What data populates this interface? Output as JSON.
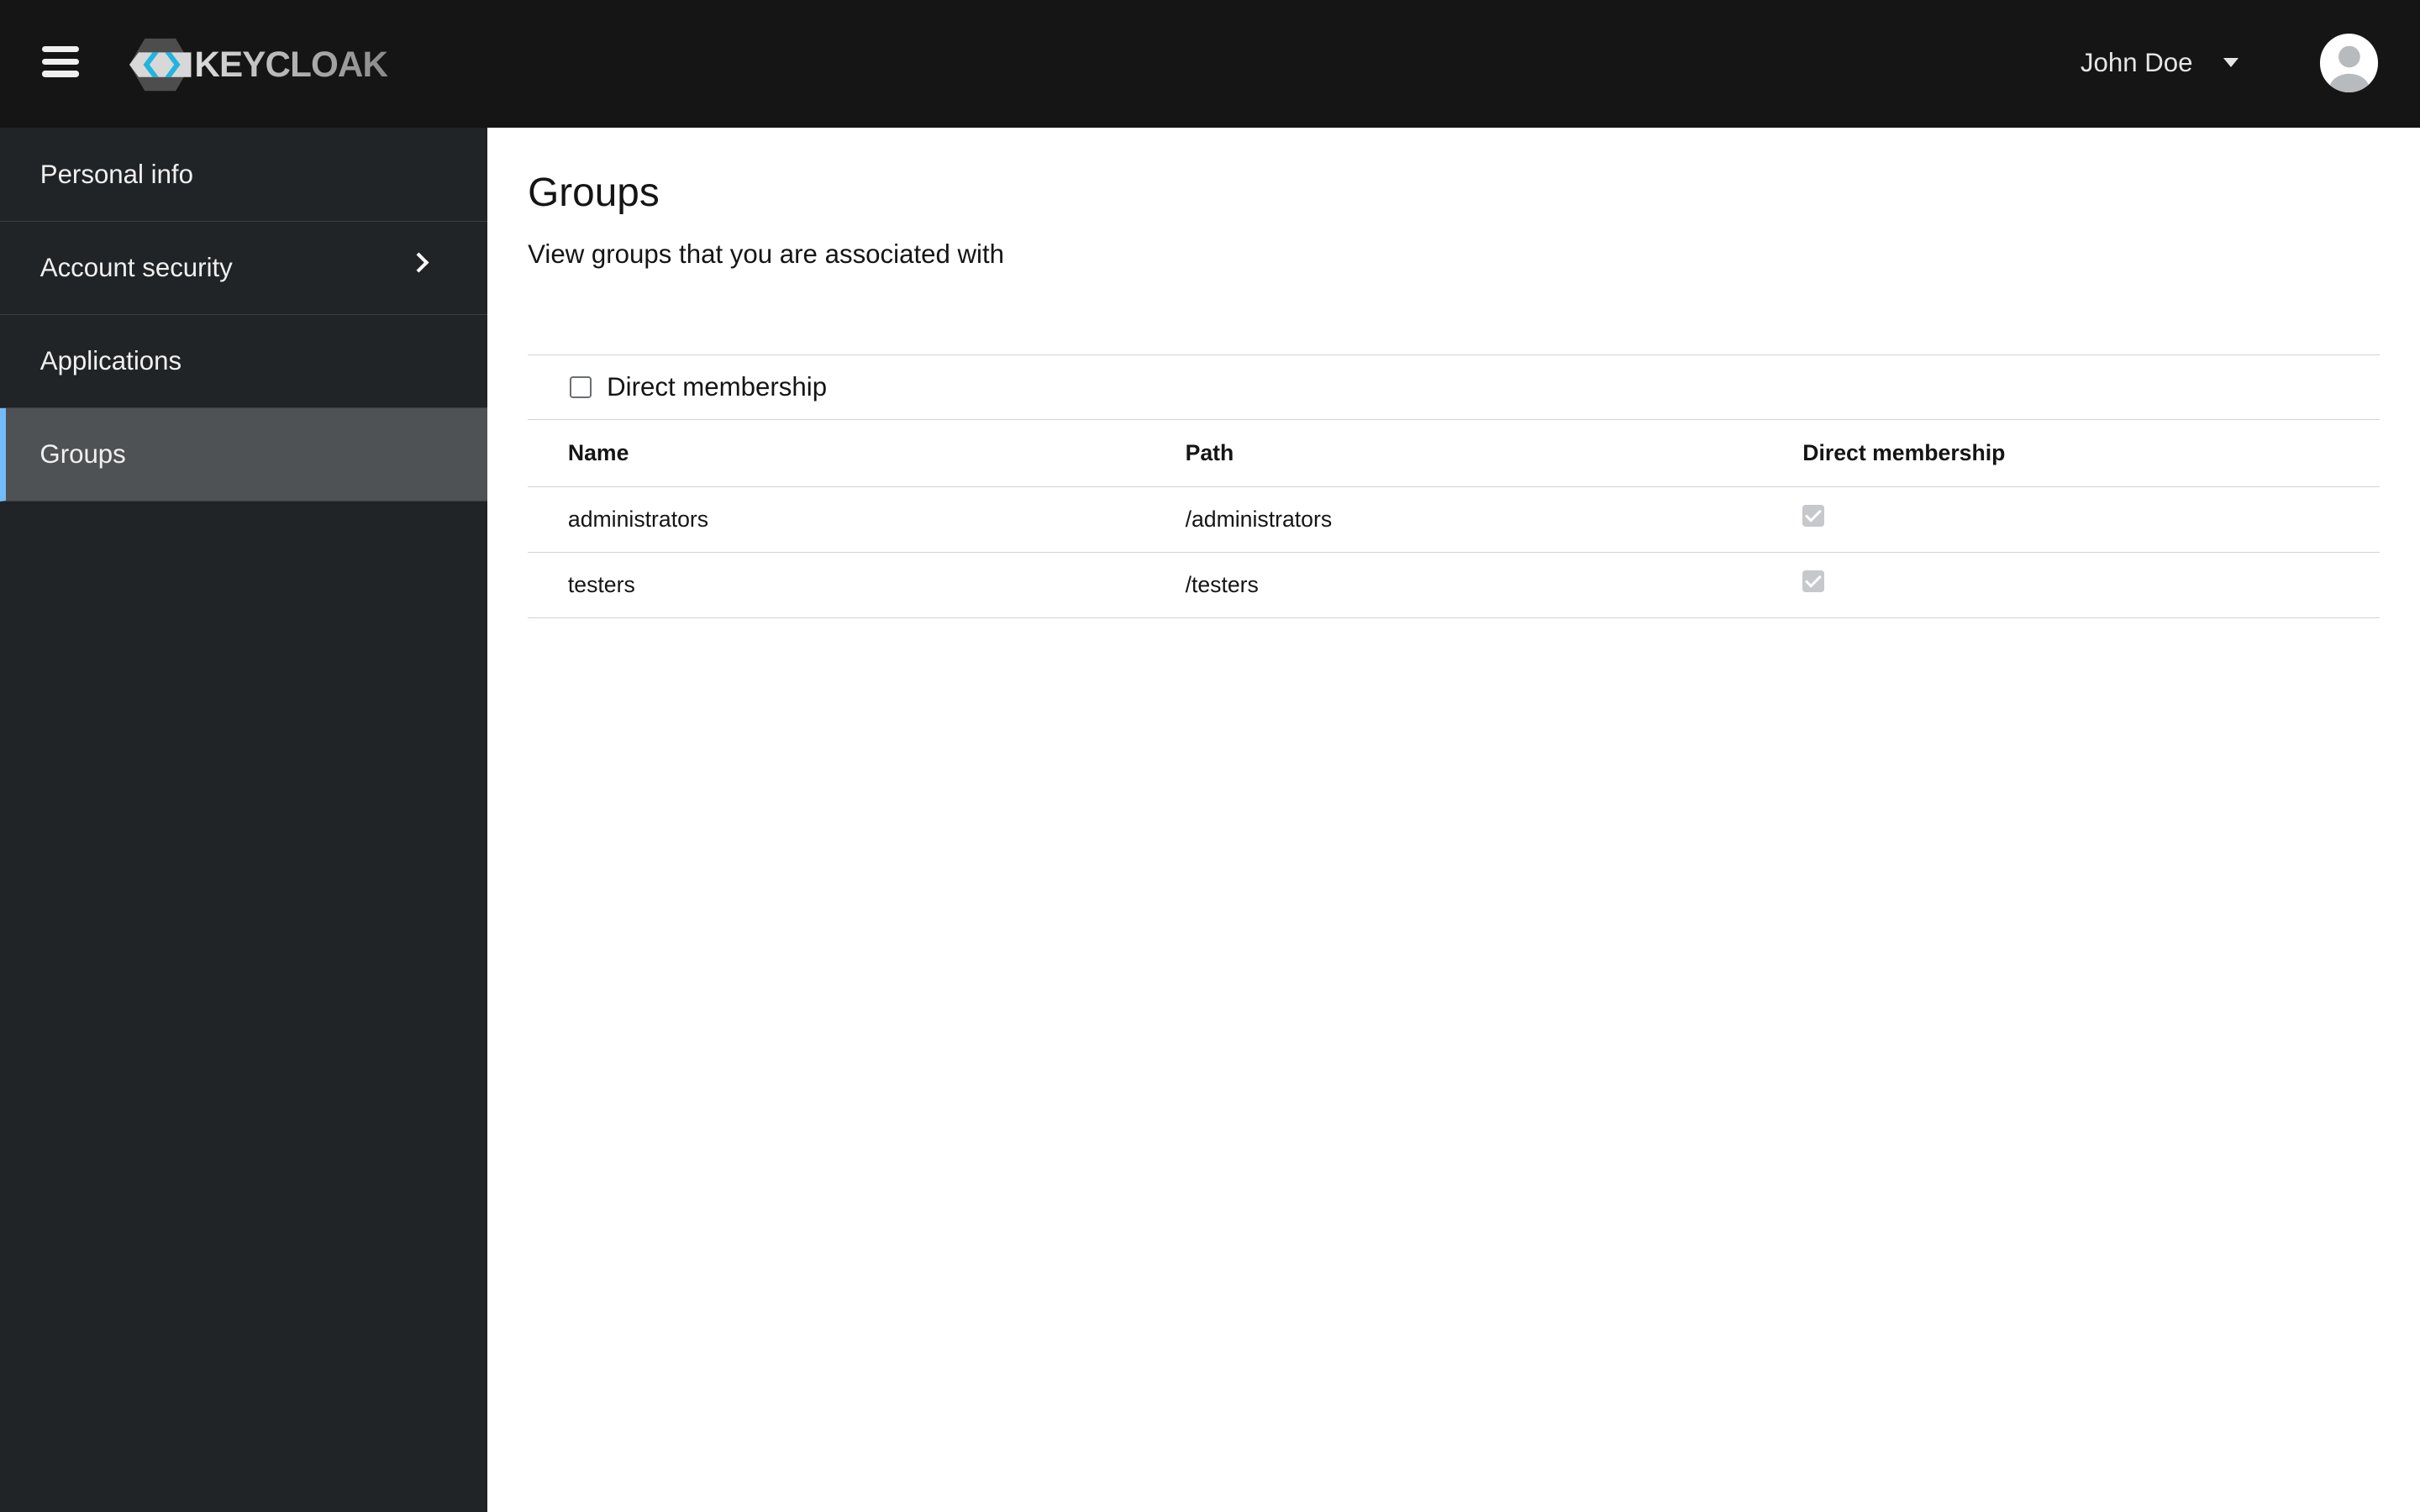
{
  "header": {
    "brand": "KEYCLOAK",
    "user_name": "John Doe"
  },
  "sidebar": {
    "items": [
      {
        "label": "Personal info"
      },
      {
        "label": "Account security"
      },
      {
        "label": "Applications"
      },
      {
        "label": "Groups"
      }
    ]
  },
  "main": {
    "title": "Groups",
    "subtitle": "View groups that you are associated with",
    "filter_label": "Direct membership",
    "filter_checked": false,
    "columns": [
      "Name",
      "Path",
      "Direct membership"
    ],
    "rows": [
      {
        "name": "administrators",
        "path": "/administrators",
        "direct": true
      },
      {
        "name": "testers",
        "path": "/testers",
        "direct": true
      }
    ]
  }
}
